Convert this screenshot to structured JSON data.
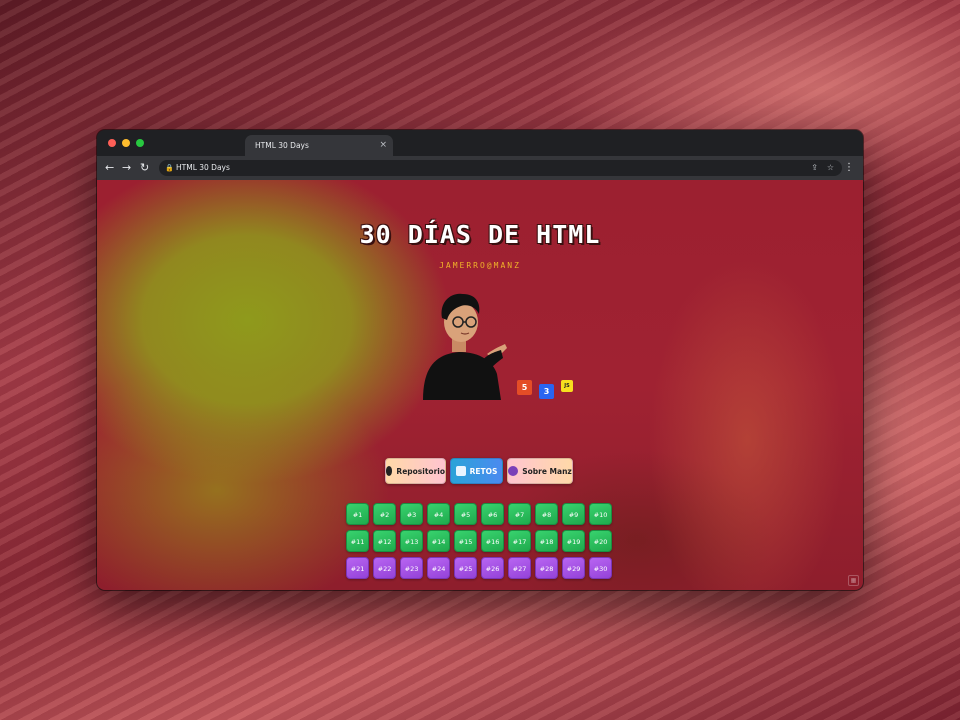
{
  "browser": {
    "tab_title": "HTML 30 Days",
    "tab_close": "×",
    "url": "HTML 30 Days",
    "nav": {
      "back": "←",
      "forward": "→",
      "reload": "↻"
    },
    "icons": {
      "share": "⇪",
      "bookmark": "☆",
      "menu": "⋮",
      "lock": "🔒"
    },
    "traffic_lights": {
      "close": "#ff5f57",
      "minimize": "#febc2e",
      "zoom": "#28c840"
    }
  },
  "page": {
    "title": "30 DÍAS DE HTML",
    "subtitle": "JAMERRO@MANZ",
    "tech_badges": {
      "html": "5",
      "css": "3",
      "js": "JS"
    },
    "buttons": {
      "repo": "Repositorio",
      "challenges": "RETOS",
      "about": "Sobre Manz"
    },
    "days": [
      "#1",
      "#2",
      "#3",
      "#4",
      "#5",
      "#6",
      "#7",
      "#8",
      "#9",
      "#10",
      "#11",
      "#12",
      "#13",
      "#14",
      "#15",
      "#16",
      "#17",
      "#18",
      "#19",
      "#20",
      "#21",
      "#22",
      "#23",
      "#24",
      "#25",
      "#26",
      "#27",
      "#28",
      "#29",
      "#30"
    ],
    "completed_days": 20,
    "total_days": 30,
    "progress_fraction": 0.667,
    "colors": {
      "accent_subtitle": "#f0b22a",
      "done": "#2ec25e",
      "pending": "#a855e8"
    }
  }
}
